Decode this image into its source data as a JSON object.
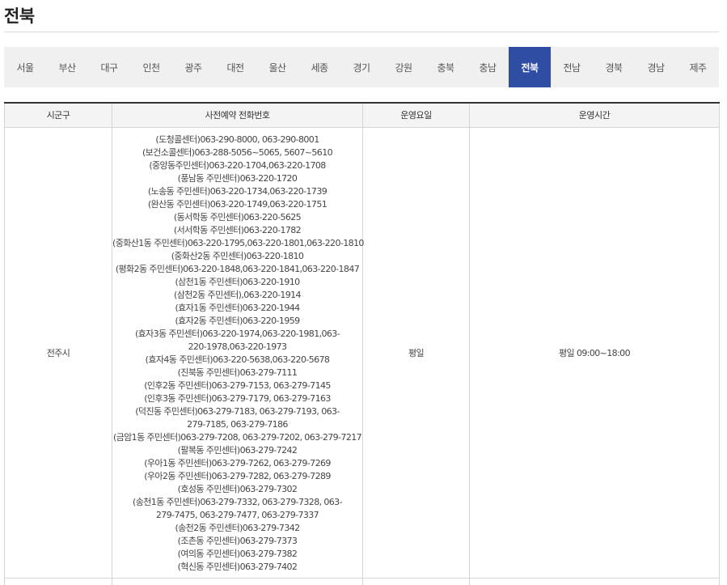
{
  "page": {
    "title": "전북"
  },
  "regions": [
    {
      "label": "서울",
      "active": false
    },
    {
      "label": "부산",
      "active": false
    },
    {
      "label": "대구",
      "active": false
    },
    {
      "label": "인천",
      "active": false
    },
    {
      "label": "광주",
      "active": false
    },
    {
      "label": "대전",
      "active": false
    },
    {
      "label": "울산",
      "active": false
    },
    {
      "label": "세종",
      "active": false
    },
    {
      "label": "경기",
      "active": false
    },
    {
      "label": "강원",
      "active": false
    },
    {
      "label": "충북",
      "active": false
    },
    {
      "label": "충남",
      "active": false
    },
    {
      "label": "전북",
      "active": true
    },
    {
      "label": "전남",
      "active": false
    },
    {
      "label": "경북",
      "active": false
    },
    {
      "label": "경남",
      "active": false
    },
    {
      "label": "제주",
      "active": false
    }
  ],
  "table": {
    "headers": [
      "시군구",
      "사전예약 전화번호",
      "운영요일",
      "운영시간"
    ],
    "rows": [
      {
        "district": "전주시",
        "days": "평일",
        "hours": "평일 09:00~18:00",
        "phones": [
          "(도청콜센터)063-290-8000, 063-290-8001",
          "(보건소콜센터)063-288-5056~5065, 5607~5610",
          "(중앙동주민센터)063-220-1704,063-220-1708",
          "(풍남동 주민센터)063-220-1720",
          "(노송동 주민센터)063-220-1734,063-220-1739",
          "(완산동 주민센터)063-220-1749,063-220-1751",
          "(동서학동 주민센터)063-220-5625",
          "(서서학동 주민센터)063-220-1782",
          "(중화산1동 주민센터)063-220-1795,063-220-1801,063-220-1810",
          "(중화산2동 주민센터)063-220-1810",
          "(평화2동 주민센터)063-220-1848,063-220-1841,063-220-1847",
          "(삼천1동 주민센터)063-220-1910",
          "(삼천2동 주민센터),063-220-1914",
          "(효자1동 주민센터)063-220-1944",
          "(효자2동 주민센터)063-220-1959",
          "(효자3동 주민센터)063-220-1974,063-220-1981,063-220-1978,063-220-1973",
          "(효자4동 주민센터)063-220-5638,063-220-5678",
          "(진북동 주민센터)063-279-7111",
          "(인후2동 주민센터)063-279-7153, 063-279-7145",
          "(인후3동 주민센터)063-279-7179, 063-279-7163",
          "(덕진동 주민센터)063-279-7183, 063-279-7193, 063-279-7185, 063-279-7186",
          "(금암1동 주민센터)063-279-7208, 063-279-7202, 063-279-7217",
          "(팔복동 주민센터)063-279-7242",
          "(우아1동 주민센터)063-279-7262, 063-279-7269",
          "(우아2동 주민센터)063-279-7282, 063-279-7289",
          "(호성동 주민센터)063-279-7302",
          "(송천1동 주민센터)063-279-7332, 063-279-7328, 063-279-7475, 063-279-7477, 063-279-7337",
          "(송천2동 주민센터)063-279-7342",
          "(조촌동 주민센터)063-279-7373",
          "(여의동 주민센터)063-279-7382",
          "(혁신동 주민센터)063-279-7402"
        ]
      }
    ]
  }
}
